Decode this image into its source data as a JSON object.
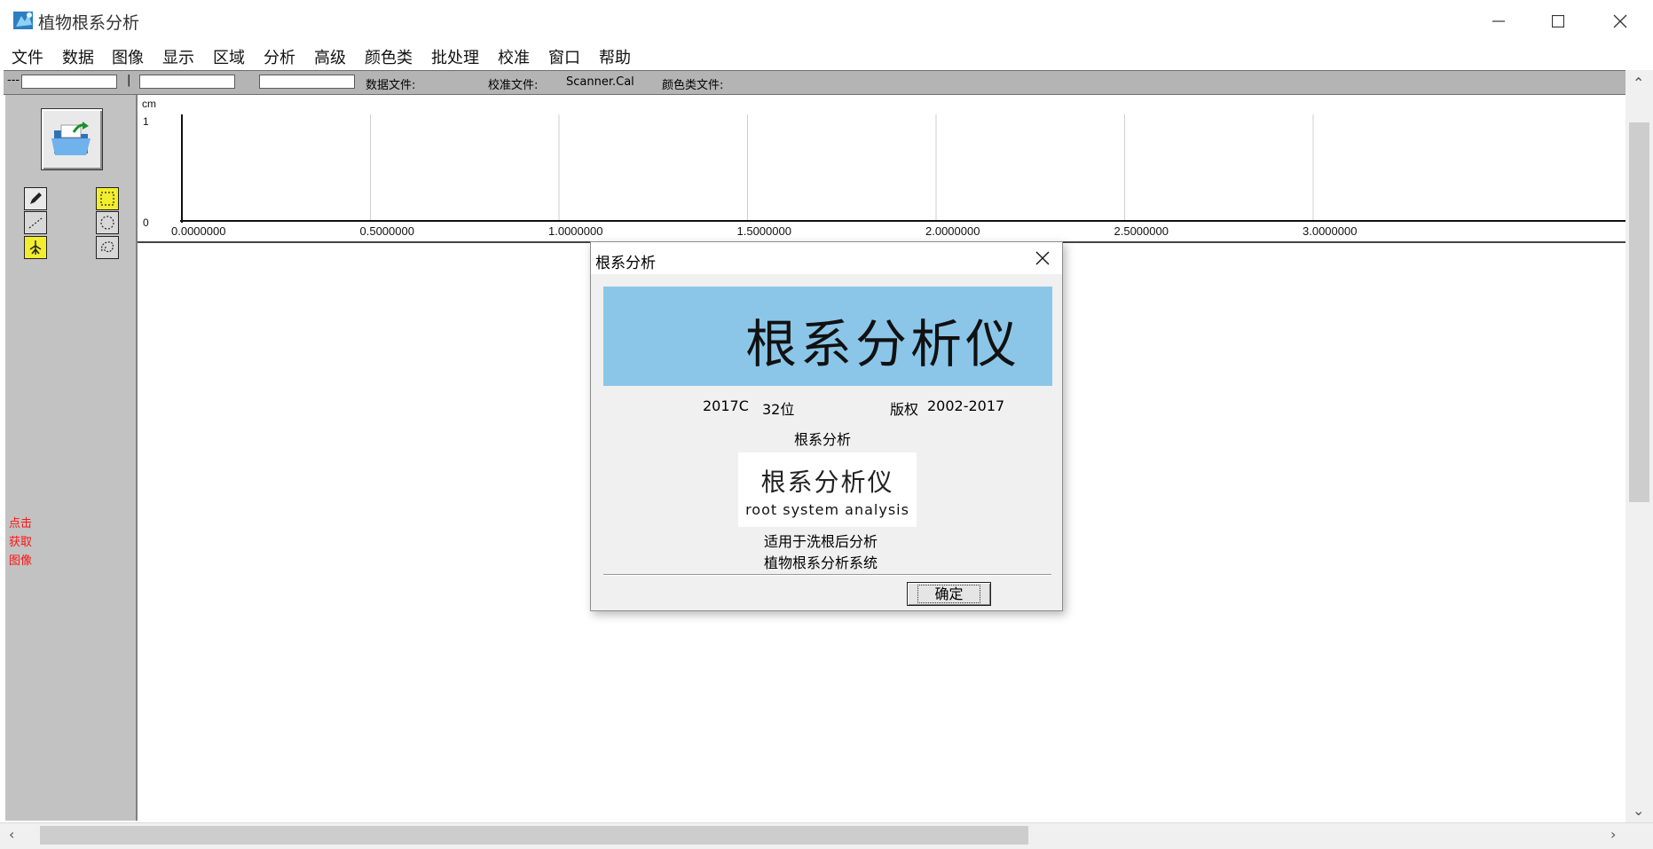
{
  "window": {
    "title": "植物根系分析",
    "controls": [
      "minimize-icon",
      "maximize-icon",
      "close-icon"
    ]
  },
  "menu": {
    "items": [
      "文件",
      "数据",
      "图像",
      "显示",
      "区域",
      "分析",
      "高级",
      "颜色类",
      "批处理",
      "校准",
      "窗口",
      "帮助"
    ]
  },
  "toolbar": {
    "prefix": "---",
    "separator": "|",
    "data_file_label": "数据文件:",
    "calib_file_label": "校准文件:",
    "calib_file_value": "Scanner.Cal",
    "color_file_label": "颜色类文件:"
  },
  "left_panel": {
    "hint": "点击\n获取\n图像",
    "tools": [
      "pencil-icon",
      "select-rect-icon",
      "dotted-line-icon",
      "select-ellipse-icon",
      "root-icon",
      "lasso-icon"
    ]
  },
  "chart_data": {
    "type": "line",
    "y_unit": "cm",
    "y_ticks": [
      "1",
      "0"
    ],
    "x_ticks": [
      "0.0000000",
      "0.5000000",
      "1.0000000",
      "1.5000000",
      "2.0000000",
      "2.5000000",
      "3.0000000"
    ],
    "ylim": [
      0,
      1
    ],
    "xlim": [
      0,
      3.2
    ],
    "grid": true,
    "series": []
  },
  "dialog": {
    "title": "根系分析",
    "banner_text": "根系分析仪",
    "version": "2017C",
    "bits": "32位",
    "copyright": "版权",
    "years": "2002-2017",
    "subtitle": "根系分析",
    "logo_cn": "根系分析仪",
    "logo_en": "root system analysis",
    "desc_line1": "适用于洗根后分析",
    "desc_line2": "植物根系分析系统",
    "ok_label": "确定"
  },
  "colors": {
    "banner": "#8bc6e8",
    "panel": "#c2c2c2",
    "tool_highlight": "#f2ee2e",
    "hint_text": "#ff1414"
  }
}
